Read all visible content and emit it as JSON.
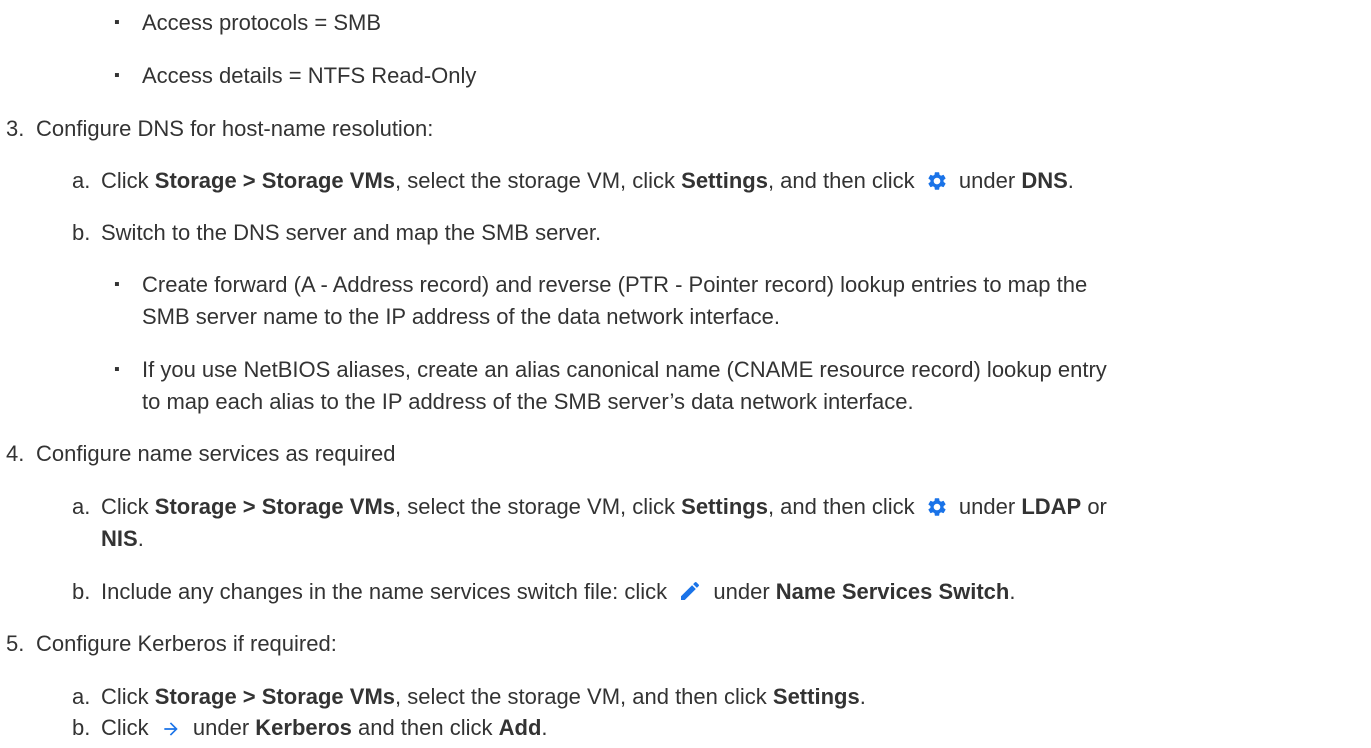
{
  "bullet_char": "▪",
  "colors": {
    "text": "#333333",
    "icon": "#1a73e8"
  },
  "icons": {
    "settings": "gear-icon",
    "edit": "pencil-icon",
    "navigate": "arrow-right-icon"
  },
  "items": {
    "bullet_protocols": "Access protocols = SMB",
    "bullet_access": "Access details = NTFS Read-Only",
    "s3": {
      "num": "3.",
      "text": "Configure DNS for host-name resolution:",
      "a": {
        "label": "a.",
        "t1": "Click ",
        "b1": "Storage > Storage VMs",
        "t2": ", select the storage VM, click ",
        "b2": "Settings",
        "t3": ", and then click ",
        "t4": " under ",
        "b3": "DNS",
        "t5": "."
      },
      "b": {
        "label": "b.",
        "text": "Switch to the DNS server and map the SMB server."
      },
      "bullet1_l1": "Create forward (A - Address record) and reverse (PTR - Pointer record) lookup entries to map the",
      "bullet1_l2": "SMB server name to the IP address of the data network interface.",
      "bullet2_l1": "If you use NetBIOS aliases, create an alias canonical name (CNAME resource record) lookup entry",
      "bullet2_l2": "to map each alias to the IP address of the SMB server’s data network interface."
    },
    "s4": {
      "num": "4.",
      "text": "Configure name services as required",
      "a": {
        "label": "a.",
        "t1": "Click ",
        "b1": "Storage > Storage VMs",
        "t2": ", select the storage VM, click ",
        "b2": "Settings",
        "t3": ", and then click ",
        "t4": " under ",
        "b3": "LDAP",
        "t5": " or",
        "b4": "NIS",
        "t6": "."
      },
      "b": {
        "label": "b.",
        "t1": "Include any changes in the name services switch file: click ",
        "t2": " under ",
        "b1": "Name Services Switch",
        "t3": "."
      }
    },
    "s5": {
      "num": "5.",
      "text": "Configure Kerberos if required:",
      "a": {
        "label": "a.",
        "t1": "Click ",
        "b1": "Storage > Storage VMs",
        "t2": ", select the storage VM, and then click ",
        "b2": "Settings",
        "t3": "."
      },
      "b": {
        "label": "b.",
        "t1": "Click ",
        "t2": " under ",
        "b1": "Kerberos",
        "t3": " and then click ",
        "b2": "Add",
        "t4": "."
      }
    }
  }
}
